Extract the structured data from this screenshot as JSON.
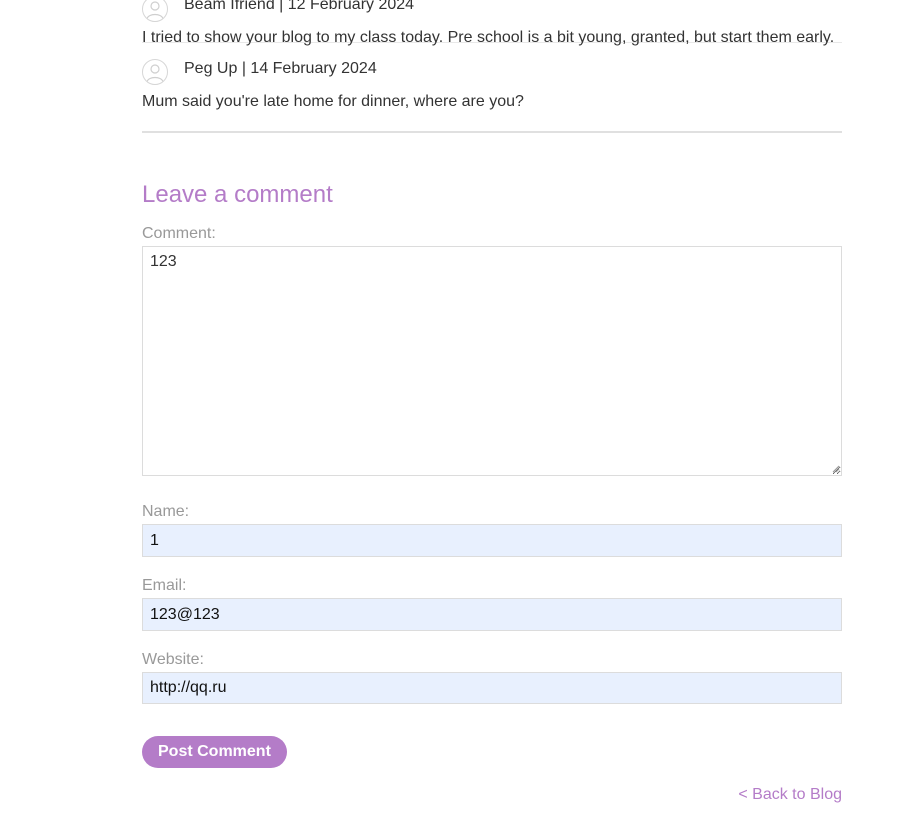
{
  "comments": [
    {
      "author": "Beam Ifriend",
      "date": "12 February 2024",
      "meta": "Beam Ifriend | 12 February 2024",
      "body": "I tried to show your blog to my class today. Pre school is a bit young, granted, but start them early."
    },
    {
      "author": "Peg Up",
      "date": "14 February 2024",
      "meta": "Peg Up | 14 February 2024",
      "body": "Mum said you're late home for dinner, where are you?"
    }
  ],
  "form": {
    "title": "Leave a comment",
    "comment_label": "Comment:",
    "comment_value": "123",
    "name_label": "Name:",
    "name_value": "1",
    "email_label": "Email:",
    "email_value": "123@123",
    "website_label": "Website:",
    "website_value": "http://qq.ru",
    "submit_label": "Post Comment"
  },
  "nav": {
    "back_label": "< Back to Blog"
  },
  "colors": {
    "accent": "#b47cc8",
    "autofill_bg": "#e8f0fe",
    "label": "#999999",
    "text": "#333333"
  },
  "icons": {
    "avatar": "user-avatar-icon"
  }
}
